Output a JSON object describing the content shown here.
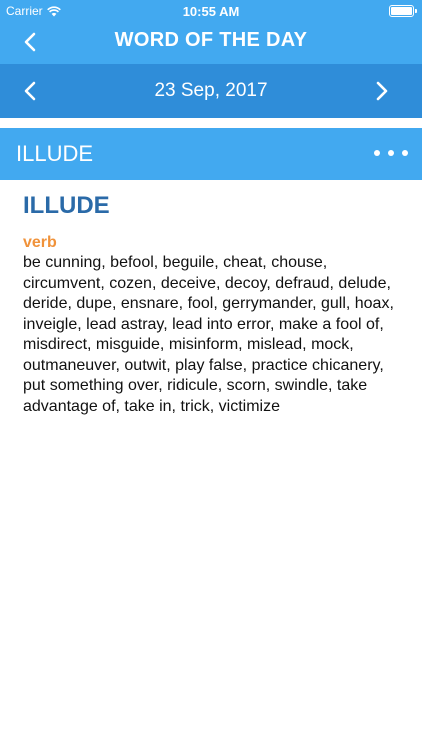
{
  "status_bar": {
    "carrier": "Carrier",
    "time": "10:55 AM",
    "icons": [
      "wifi-icon",
      "battery-icon"
    ]
  },
  "nav": {
    "title": "WORD OF THE DAY",
    "back_icon": "chevron-left-icon"
  },
  "date_nav": {
    "date": "23 Sep, 2017",
    "prev_icon": "chevron-left-icon",
    "next_icon": "chevron-right-icon"
  },
  "word_bar": {
    "title": "ILLUDE",
    "more_icon": "more-dots-icon"
  },
  "entry": {
    "headword": "ILLUDE",
    "part_of_speech": "verb",
    "definition": "be cunning, befool, beguile, cheat, chouse, circumvent, cozen, deceive, decoy, defraud, delude, deride, dupe, ensnare, fool, gerrymander, gull, hoax, inveigle, lead astray, lead into error, make a fool of, misdirect, misguide, misinform, mislead, mock, outmaneuver, outwit, play false, practice chicanery, put something over, ridicule, scorn, swindle, take advantage of, take in, trick, victimize"
  },
  "colors": {
    "primary": "#42a9f0",
    "primary_dark": "#2f8dd9",
    "headword": "#2a6aa8",
    "part_of_speech": "#f0923a"
  }
}
